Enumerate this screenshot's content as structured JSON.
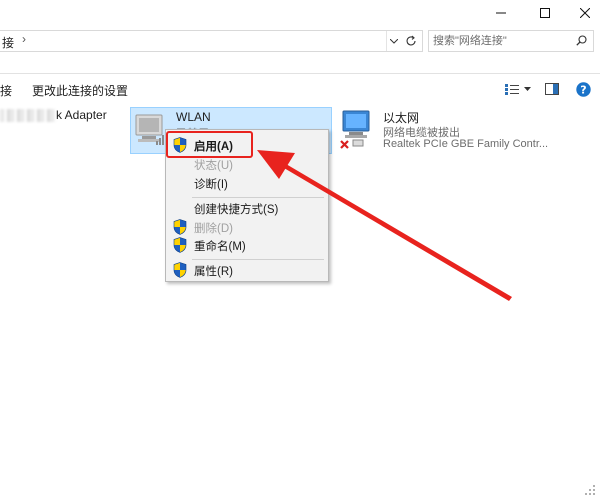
{
  "address": {
    "crumb_tail": "接"
  },
  "search": {
    "placeholder": "搜索\"网络连接\""
  },
  "commands": {
    "left_partial": "接",
    "change_settings": "更改此连接的设置"
  },
  "items": {
    "left_adapter_partial": "k Adapter",
    "wlan": {
      "name": "WLAN",
      "status_partial": "已禁用"
    },
    "ethernet": {
      "name": "以太网",
      "status": "网络电缆被拔出",
      "device": "Realtek PCIe GBE Family Contr..."
    }
  },
  "context_menu": {
    "items": [
      {
        "label": "启用(A)",
        "shield": true,
        "enabled": true,
        "bold": true
      },
      {
        "label": "状态(U)",
        "shield": false,
        "enabled": false
      },
      {
        "label": "诊断(I)",
        "shield": false,
        "enabled": true
      },
      {
        "label": "创建快捷方式(S)",
        "shield": false,
        "enabled": true
      },
      {
        "label": "删除(D)",
        "shield": true,
        "enabled": false
      },
      {
        "label": "重命名(M)",
        "shield": true,
        "enabled": true
      },
      {
        "label": "属性(R)",
        "shield": true,
        "enabled": true
      }
    ]
  },
  "colors": {
    "selection_bg": "#cce8ff",
    "selection_border": "#99d1ff",
    "annotation_red": "#e8231e",
    "help_blue": "#1a73c9"
  },
  "icons": {
    "minimize": "minimize-icon",
    "maximize": "maximize-icon",
    "close": "close-icon",
    "refresh": "refresh-icon",
    "search": "search-icon",
    "view": "view-options-icon",
    "preview_pane": "preview-pane-icon",
    "help": "help-icon",
    "uac_shield": "uac-shield-icon"
  }
}
